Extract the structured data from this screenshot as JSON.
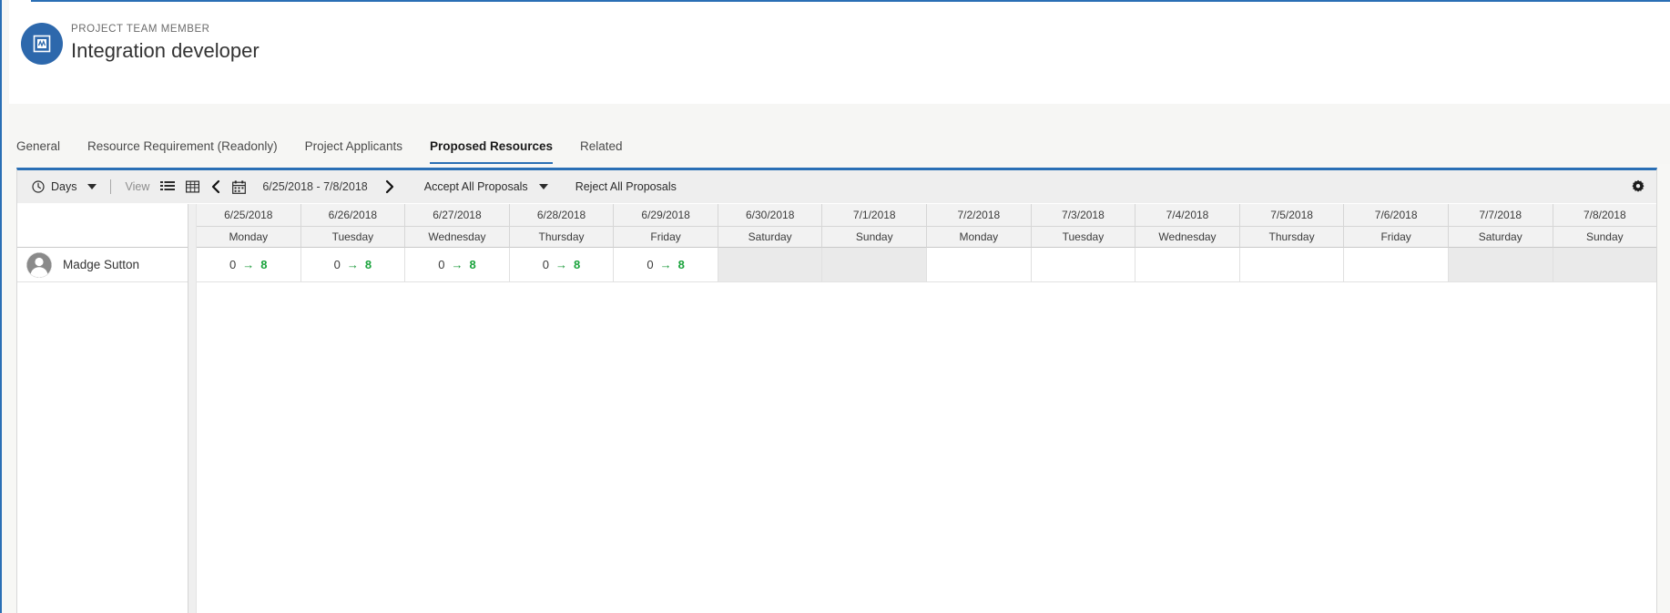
{
  "header": {
    "entity_type": "PROJECT TEAM MEMBER",
    "title": "Integration developer",
    "icon": "project-team-member-icon",
    "accent_color": "#2d68ac"
  },
  "tabs": [
    {
      "label": "General",
      "active": false
    },
    {
      "label": "Resource Requirement (Readonly)",
      "active": false
    },
    {
      "label": "Project Applicants",
      "active": false
    },
    {
      "label": "Proposed Resources",
      "active": true
    },
    {
      "label": "Related",
      "active": false
    }
  ],
  "toolbar": {
    "scale_label": "Days",
    "scale_icon": "clock-icon",
    "view_label": "View",
    "list_view_icon": "list-view-icon",
    "grid_view_icon": "grid-view-icon",
    "prev_icon": "chevron-left-icon",
    "next_icon": "chevron-right-icon",
    "calendar_icon": "calendar-icon",
    "date_range": "6/25/2018 - 7/8/2018",
    "accept_all_label": "Accept All Proposals",
    "reject_all_label": "Reject All Proposals",
    "settings_icon": "gear-icon"
  },
  "grid": {
    "resource_header": "",
    "columns": [
      {
        "date": "6/25/2018",
        "day": "Monday",
        "nonworking": false
      },
      {
        "date": "6/26/2018",
        "day": "Tuesday",
        "nonworking": false
      },
      {
        "date": "6/27/2018",
        "day": "Wednesday",
        "nonworking": false
      },
      {
        "date": "6/28/2018",
        "day": "Thursday",
        "nonworking": false
      },
      {
        "date": "6/29/2018",
        "day": "Friday",
        "nonworking": false
      },
      {
        "date": "6/30/2018",
        "day": "Saturday",
        "nonworking": true
      },
      {
        "date": "7/1/2018",
        "day": "Sunday",
        "nonworking": true
      },
      {
        "date": "7/2/2018",
        "day": "Monday",
        "nonworking": false
      },
      {
        "date": "7/3/2018",
        "day": "Tuesday",
        "nonworking": false
      },
      {
        "date": "7/4/2018",
        "day": "Wednesday",
        "nonworking": false
      },
      {
        "date": "7/5/2018",
        "day": "Thursday",
        "nonworking": false
      },
      {
        "date": "7/6/2018",
        "day": "Friday",
        "nonworking": false
      },
      {
        "date": "7/7/2018",
        "day": "Saturday",
        "nonworking": true
      },
      {
        "date": "7/8/2018",
        "day": "Sunday",
        "nonworking": true
      }
    ],
    "rows": [
      {
        "name": "Madge Sutton",
        "avatar": "person-avatar",
        "cells": [
          {
            "from": "0",
            "arrow": "→",
            "to": "8"
          },
          {
            "from": "0",
            "arrow": "→",
            "to": "8"
          },
          {
            "from": "0",
            "arrow": "→",
            "to": "8"
          },
          {
            "from": "0",
            "arrow": "→",
            "to": "8"
          },
          {
            "from": "0",
            "arrow": "→",
            "to": "8"
          },
          null,
          null,
          null,
          null,
          null,
          null,
          null,
          null,
          null
        ]
      }
    ]
  },
  "colors": {
    "accent": "#2a6fb5",
    "proposed_value": "#1aa33c",
    "nonworking_cell": "#eaeaea",
    "toolbar_bg": "#eeeeee"
  }
}
